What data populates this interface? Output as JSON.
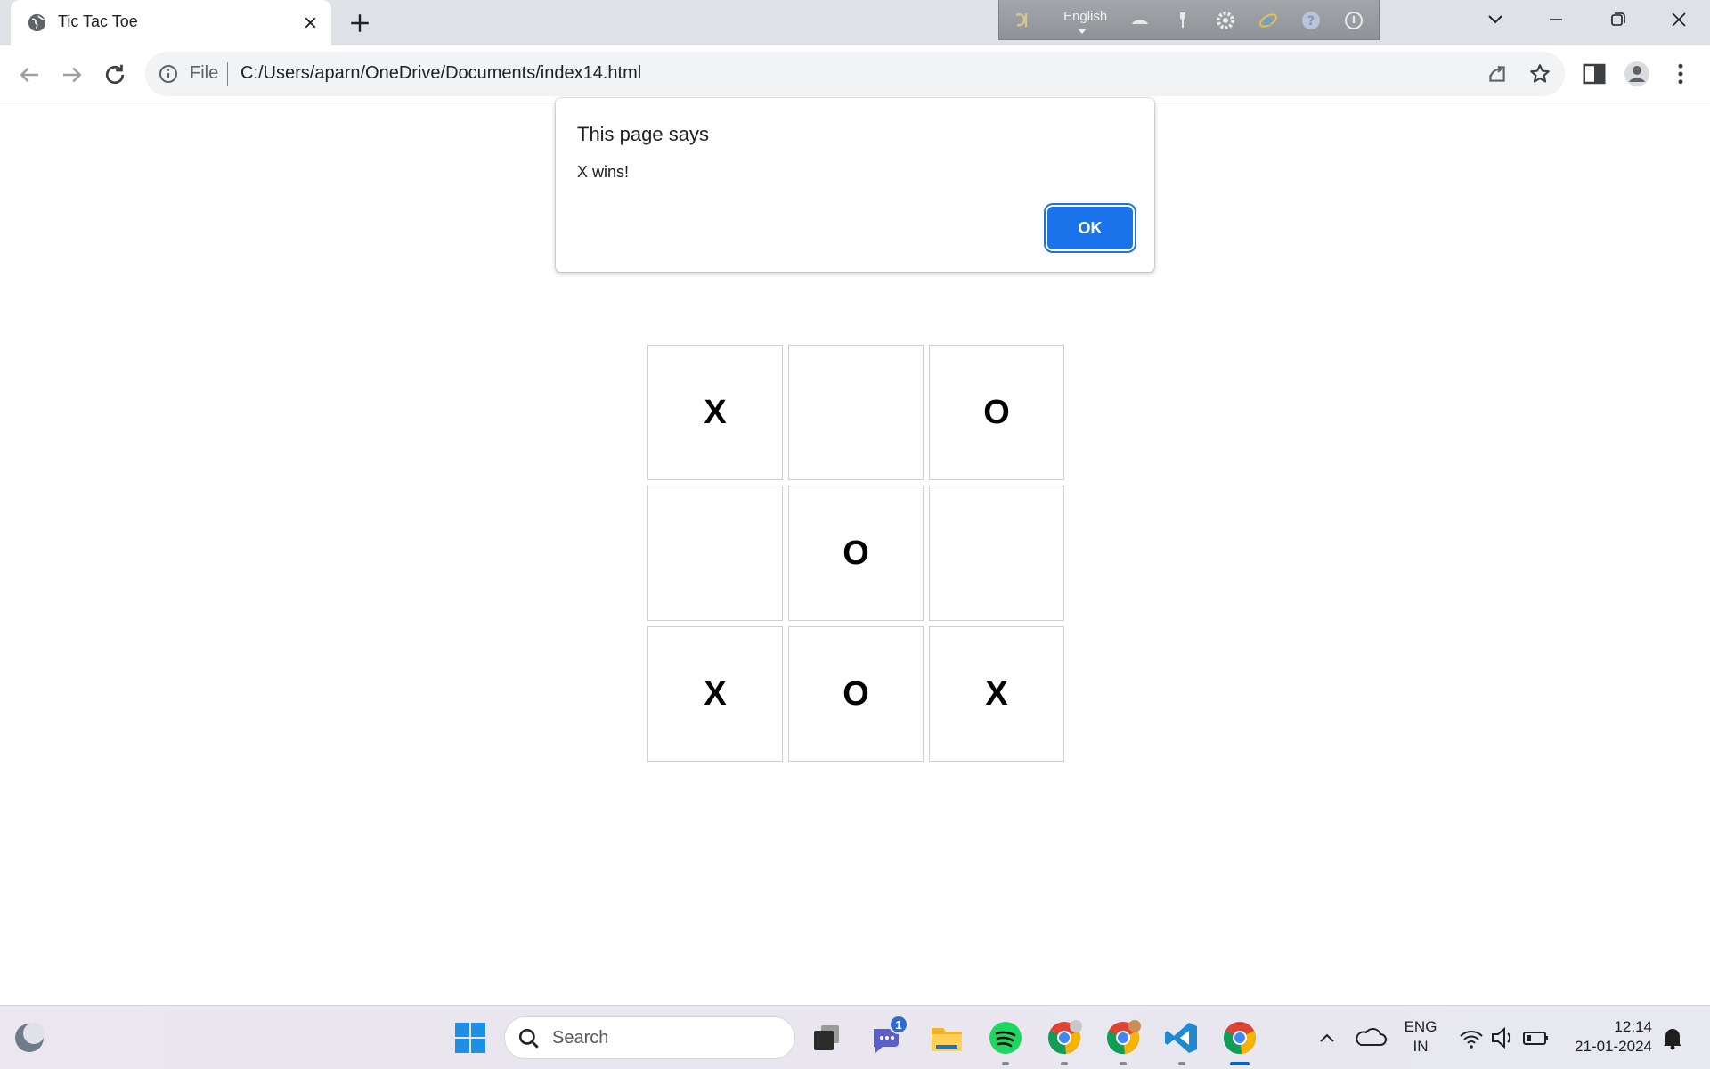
{
  "browser": {
    "tab_title": "Tic Tac Toe",
    "ime_language": "English",
    "scheme_label": "File",
    "url": "C:/Users/aparn/OneDrive/Documents/index14.html"
  },
  "dialog": {
    "title": "This page says",
    "message": "X wins!",
    "ok_label": "OK"
  },
  "board": {
    "cells": [
      "X",
      "",
      "O",
      "",
      "O",
      "",
      "X",
      "O",
      "X"
    ]
  },
  "taskbar": {
    "search_placeholder": "Search",
    "chat_badge": "1",
    "language": "ENG",
    "region": "IN",
    "time": "12:14",
    "date": "21-01-2024"
  },
  "colors": {
    "accent": "#1a73e8",
    "tabstrip": "#dee1e6",
    "omnibox": "#f1f3f4"
  }
}
